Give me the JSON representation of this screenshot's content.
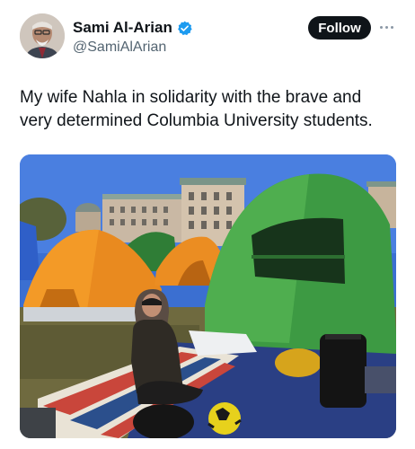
{
  "author": {
    "name": "Sami Al-Arian",
    "handle": "@SamiAlArian",
    "verified": true
  },
  "actions": {
    "follow_label": "Follow",
    "more_icon": "more-horizontal-icon"
  },
  "tweet": {
    "text": "My wife Nahla in solidarity with the brave and very determined Columbia University students."
  },
  "colors": {
    "verified_blue": "#1d9bf0",
    "follow_bg": "#0f1419"
  }
}
